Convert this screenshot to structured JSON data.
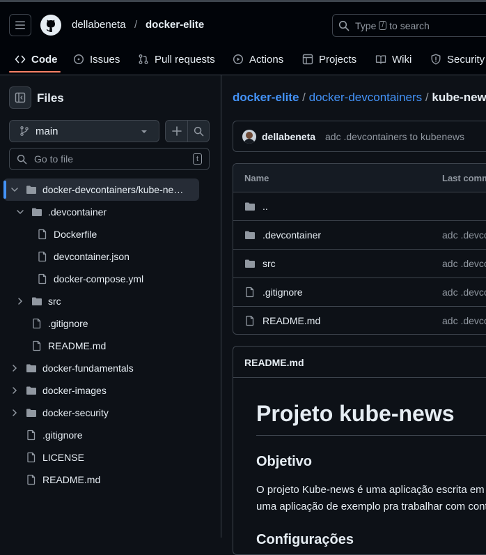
{
  "header": {
    "owner": "dellabeneta",
    "separator": "/",
    "repo": "docker-elite",
    "search": {
      "prefix": "Type",
      "key": "/",
      "suffix": "to search"
    }
  },
  "nav": {
    "tabs": [
      {
        "label": "Code",
        "icon": "code-icon",
        "active": true
      },
      {
        "label": "Issues",
        "icon": "issue-icon"
      },
      {
        "label": "Pull requests",
        "icon": "pull-request-icon"
      },
      {
        "label": "Actions",
        "icon": "play-icon"
      },
      {
        "label": "Projects",
        "icon": "table-icon"
      },
      {
        "label": "Wiki",
        "icon": "book-icon"
      },
      {
        "label": "Security",
        "icon": "shield-icon"
      }
    ]
  },
  "sidebar": {
    "title": "Files",
    "branch": "main",
    "goto_placeholder": "Go to file",
    "goto_key": "t",
    "tree": [
      {
        "label": "docker-devcontainers/kube-ne…",
        "type": "folder",
        "expanded": true,
        "selected": true
      },
      {
        "label": ".devcontainer",
        "type": "folder",
        "expanded": true
      },
      {
        "label": "Dockerfile",
        "type": "file"
      },
      {
        "label": "devcontainer.json",
        "type": "file"
      },
      {
        "label": "docker-compose.yml",
        "type": "file"
      },
      {
        "label": "src",
        "type": "folder",
        "expanded": false
      },
      {
        "label": ".gitignore",
        "type": "file"
      },
      {
        "label": "README.md",
        "type": "file"
      },
      {
        "label": "docker-fundamentals",
        "type": "folder",
        "expanded": false
      },
      {
        "label": "docker-images",
        "type": "folder",
        "expanded": false
      },
      {
        "label": "docker-security",
        "type": "folder",
        "expanded": false
      },
      {
        "label": ".gitignore",
        "type": "file"
      },
      {
        "label": "LICENSE",
        "type": "file"
      },
      {
        "label": "README.md",
        "type": "file"
      }
    ]
  },
  "main": {
    "breadcrumb": {
      "part1": "docker-elite",
      "part2": "docker-devcontainers",
      "current": "kube-news",
      "sep": "/"
    },
    "commit": {
      "author": "dellabeneta",
      "message": "adc .devcontainers to kubenews"
    },
    "table": {
      "col_name": "Name",
      "col_commit": "Last commit message",
      "rows": [
        {
          "name": "..",
          "type": "folder",
          "commit": ""
        },
        {
          "name": ".devcontainer",
          "type": "folder",
          "commit": "adc .devcontainers to kubenews"
        },
        {
          "name": "src",
          "type": "folder",
          "commit": "adc .devcontainers to kubenews"
        },
        {
          "name": ".gitignore",
          "type": "file",
          "commit": "adc .devcontainers to kubenews"
        },
        {
          "name": "README.md",
          "type": "file",
          "commit": "adc .devcontainers to kubenews"
        }
      ]
    },
    "readme": {
      "label": "README.md",
      "h1": "Projeto kube-news",
      "h2": "Objetivo",
      "p_line1": "O projeto Kube-news é uma aplicação escrita em Node.js",
      "p_line2": "uma aplicação de exemplo pra trabalhar com containers.",
      "h2b": "Configurações"
    }
  },
  "colors": {
    "accent": "#4493f8",
    "tab_underline": "#f78166",
    "folder": "#9198a1"
  }
}
